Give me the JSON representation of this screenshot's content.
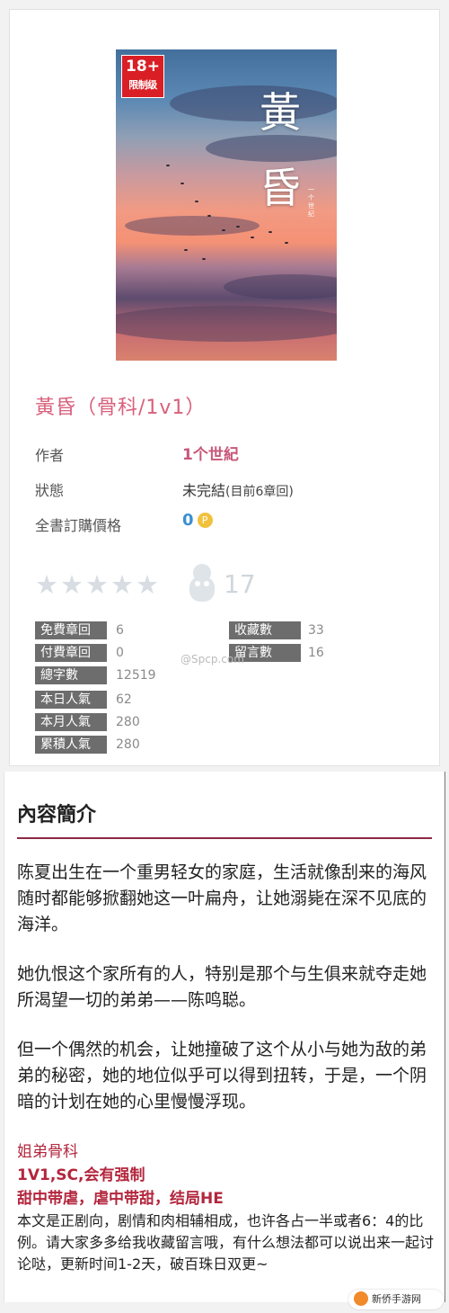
{
  "cover": {
    "badge_age": "18+",
    "badge_text": "限制级",
    "title_chars": [
      "黃",
      "昏"
    ],
    "author_mark": "一个世纪"
  },
  "book": {
    "title": "黃昏（骨科/1v1）"
  },
  "info": {
    "author_label": "作者",
    "author_value": "1个世紀",
    "status_label": "狀態",
    "status_value": "未完結",
    "status_sub": "(目前6章回)",
    "price_label": "全書訂購價格",
    "price_value": "0",
    "coin_symbol": "P"
  },
  "rating": {
    "stars": "★★★★★",
    "favorite_count": "17"
  },
  "stats": {
    "free_chapters_label": "免費章回",
    "free_chapters_value": "6",
    "paid_chapters_label": "付費章回",
    "paid_chapters_value": "0",
    "word_count_label": "總字數",
    "word_count_value": "12519",
    "today_pop_label": "本日人氣",
    "today_pop_value": "62",
    "month_pop_label": "本月人氣",
    "month_pop_value": "280",
    "total_pop_label": "累積人氣",
    "total_pop_value": "280",
    "collect_label": "收藏數",
    "collect_value": "33",
    "comment_label": "留言數",
    "comment_value": "16",
    "watermark": "@Spcp.com"
  },
  "synopsis": {
    "heading": "內容簡介",
    "paragraphs": [
      "陈夏出生在一个重男轻女的家庭，生活就像刮来的海风随时都能够掀翻她这一叶扁舟，让她溺毙在深不见底的海洋。",
      "她仇恨这个家所有的人，特别是那个与生俱来就夺走她所渴望一切的弟弟——陈鸣聪。",
      "但一个偶然的机会，让她撞破了这个从小与她为敌的弟弟的秘密，她的地位似乎可以得到扭转，于是，一个阴暗的计划在她的心里慢慢浮现。"
    ],
    "tags": [
      "姐弟骨科",
      "1V1,SC,会有强制",
      "甜中带虐，虐中带甜，结局HE"
    ],
    "note": "本文是正剧向，剧情和肉相辅相成，也许各占一半或者6：4的比例。请大家多多给我收藏留言哦，有什么想法都可以说出来一起讨论哒，更新时间1-2天，破百珠日双更~"
  },
  "site_logo_text": "新侨手游网"
}
